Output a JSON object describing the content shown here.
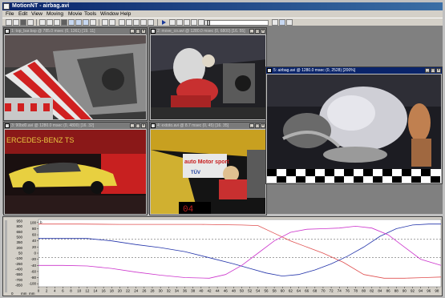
{
  "app": {
    "title": "MotionNT - airbag.avi"
  },
  "menu": [
    {
      "label": "File"
    },
    {
      "label": "Edit"
    },
    {
      "label": "View"
    },
    {
      "label": "Moving"
    },
    {
      "label": "Movie"
    },
    {
      "label": "Tools"
    },
    {
      "label": "Window"
    },
    {
      "label": "Help"
    }
  ],
  "windows": [
    {
      "name": "window-1",
      "title": "1: top_bar.bsp @ 785.0 msec (0, 1361) [19. 11]",
      "active": false
    },
    {
      "name": "window-2",
      "title": "2: move_co.avi @ 1280.0 msec (0, 6800) [16. 55]",
      "active": false
    },
    {
      "name": "window-3",
      "title": "3: 90bd0.avi @ 1280.0 msec (0, 4800) [16. 32]",
      "active": false
    },
    {
      "name": "window-4",
      "title": "4: extoto.avi @ 8.7 msec (0, 45) [16. 35]",
      "active": false
    },
    {
      "name": "window-5",
      "title": "5: airbag.avi @ 1280.0 msec (0, 2528) [200%]",
      "active": true
    }
  ],
  "video": {
    "w3_brand_text": "ERCEDES-BENZ TS",
    "w4_sign_text": "auto Motor sport",
    "w4_sign_text2": "TÜV",
    "w4_seg_display": "04"
  },
  "chart_data": {
    "type": "line",
    "yticks": [
      100,
      80,
      60,
      40,
      20,
      0,
      -20,
      -40,
      -60,
      -80,
      -100
    ],
    "ylim": [
      -110,
      110
    ],
    "yticks_right": [
      950,
      800,
      650,
      500,
      350,
      200,
      50,
      -100,
      -250,
      -400,
      -550,
      -700,
      -850
    ],
    "xlim": [
      0,
      99
    ],
    "xticks": [
      0,
      2,
      4,
      6,
      8,
      10,
      12,
      14,
      16,
      18,
      20,
      22,
      24,
      26,
      28,
      30,
      32,
      34,
      36,
      38,
      40,
      42,
      44,
      46,
      48,
      50,
      52,
      54,
      56,
      58,
      60,
      62,
      64,
      66,
      68,
      70,
      72,
      74,
      76,
      78,
      80,
      82,
      84,
      86,
      88,
      90,
      92,
      94,
      96,
      98
    ],
    "y_marker_label": "b",
    "x_axis_marks": [
      "0",
      "mm",
      "mm"
    ],
    "grid_lines_y": [
      45,
      -15
    ],
    "series": [
      {
        "color": "#e05050",
        "x": [
          0,
          10,
          20,
          30,
          40,
          45,
          50,
          54,
          58,
          62,
          66,
          70,
          75,
          80,
          85,
          90,
          95,
          99
        ],
        "y": [
          95,
          95,
          94,
          94,
          94,
          93,
          92,
          90,
          65,
          40,
          20,
          0,
          -30,
          -70,
          -82,
          -82,
          -80,
          -78
        ]
      },
      {
        "color": "#2233aa",
        "x": [
          0,
          6,
          12,
          18,
          24,
          30,
          36,
          42,
          48,
          52,
          56,
          60,
          64,
          68,
          72,
          76,
          80,
          84,
          88,
          92,
          96,
          99
        ],
        "y": [
          48,
          48,
          48,
          40,
          28,
          18,
          5,
          -15,
          -35,
          -50,
          -65,
          -75,
          -70,
          -55,
          -35,
          -10,
          20,
          55,
          80,
          92,
          95,
          95
        ]
      },
      {
        "color": "#cc33cc",
        "x": [
          0,
          6,
          12,
          18,
          24,
          30,
          36,
          42,
          46,
          50,
          54,
          58,
          62,
          66,
          70,
          74,
          78,
          82,
          86,
          90,
          94,
          99
        ],
        "y": [
          -40,
          -40,
          -42,
          -50,
          -62,
          -72,
          -80,
          -82,
          -70,
          -40,
          0,
          40,
          68,
          78,
          80,
          82,
          88,
          82,
          60,
          20,
          -20,
          -40
        ]
      }
    ]
  }
}
